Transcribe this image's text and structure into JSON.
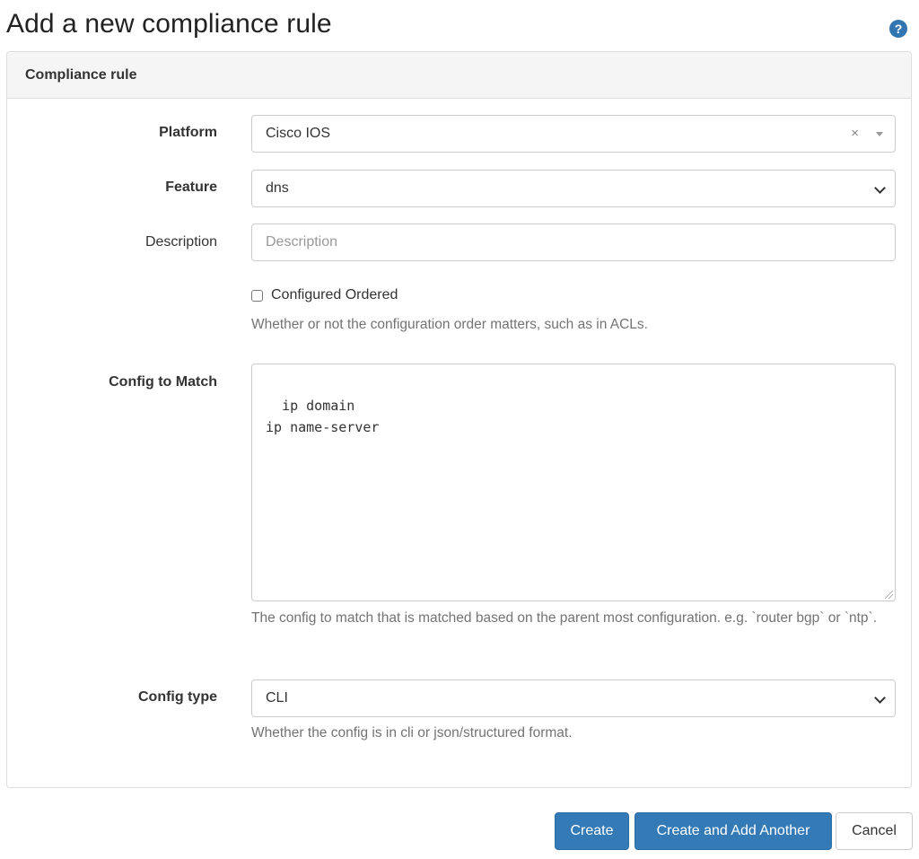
{
  "page": {
    "title": "Add a new compliance rule",
    "help_icon": "question-circle-icon",
    "help_glyph": "?"
  },
  "panel": {
    "heading": "Compliance rule"
  },
  "form": {
    "platform": {
      "label": "Platform",
      "value": "Cisco IOS",
      "clear_glyph": "×"
    },
    "feature": {
      "label": "Feature",
      "value": "dns"
    },
    "description": {
      "label": "Description",
      "placeholder": "Description",
      "value": ""
    },
    "configured_ordered": {
      "label": "Configured Ordered",
      "checked": false,
      "help": "Whether or not the configuration order matters, such as in ACLs."
    },
    "config_to_match": {
      "label": "Config to Match",
      "value": "ip domain\nip name-server",
      "help": "The config to match that is matched based on the parent most configuration. e.g. `router bgp` or `ntp`."
    },
    "config_type": {
      "label": "Config type",
      "value": "CLI",
      "help": "Whether the config is in cli or json/structured format."
    }
  },
  "buttons": {
    "create": "Create",
    "create_and_add": "Create and Add Another",
    "cancel": "Cancel"
  },
  "colors": {
    "primary": "#337ab7",
    "panel_heading_bg": "#f5f5f5",
    "help_text": "#737373"
  }
}
